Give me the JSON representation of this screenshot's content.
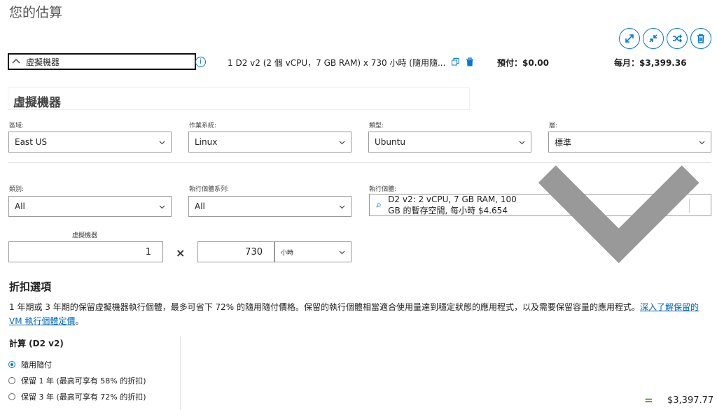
{
  "page": {
    "title": "您的估算"
  },
  "toolbar": {
    "icons": [
      "expand-icon",
      "collapse-icon",
      "shuffle-icon",
      "delete-icon"
    ]
  },
  "estimate": {
    "name": "虛擬機器",
    "summary": "1 D2 v2 (2 個 vCPU，7 GB RAM) x 730 小時 (隨用隨...",
    "upfront": "預付：$0.00",
    "monthly": "每月：$3,399.36"
  },
  "section": {
    "title": "虛擬機器"
  },
  "fields": {
    "region": {
      "label": "區域:",
      "value": "East US"
    },
    "os": {
      "label": "作業系統:",
      "value": "Linux"
    },
    "type": {
      "label": "類型:",
      "value": "Ubuntu"
    },
    "tier": {
      "label": "層:",
      "value": "標準"
    },
    "category": {
      "label": "類別:",
      "value": "All"
    },
    "series": {
      "label": "執行個體系列:",
      "value": "All"
    },
    "instance": {
      "label": "執行個體:",
      "value": "D2 v2: 2 vCPU, 7 GB RAM, 100 GB 的暫存空間, 每小時 $4.654"
    },
    "vm_count": {
      "label": "虛擬機器",
      "value": "1"
    },
    "hours": {
      "value": "730"
    },
    "hours_unit": {
      "value": "小時"
    }
  },
  "discount": {
    "title": "折扣選項",
    "text": "1 年期或 3 年期的保留虛擬機器執行個體，最多可省下 72% 的隨用隨付價格。保留的執行個體相當適合使用量達到穩定狀態的應用程式，以及需要保留容量的應用程式。",
    "link": "深入了解保留的 VM 執行個體定價",
    "after_link": "。"
  },
  "compute": {
    "title": "計算 (D2 v2)",
    "options": [
      {
        "label": "隨用隨付",
        "selected": true
      },
      {
        "label": "保留 1 年 (最高可享有 58% 的折扣)",
        "selected": false
      },
      {
        "label": "保留 3 年 (最高可享有 72% 的折扣)",
        "selected": false
      }
    ],
    "equals": "=",
    "total": "$3,397.77"
  },
  "colors": {
    "accent": "#0078d4",
    "link": "#0067b8",
    "equals": "#2e9e2e"
  }
}
